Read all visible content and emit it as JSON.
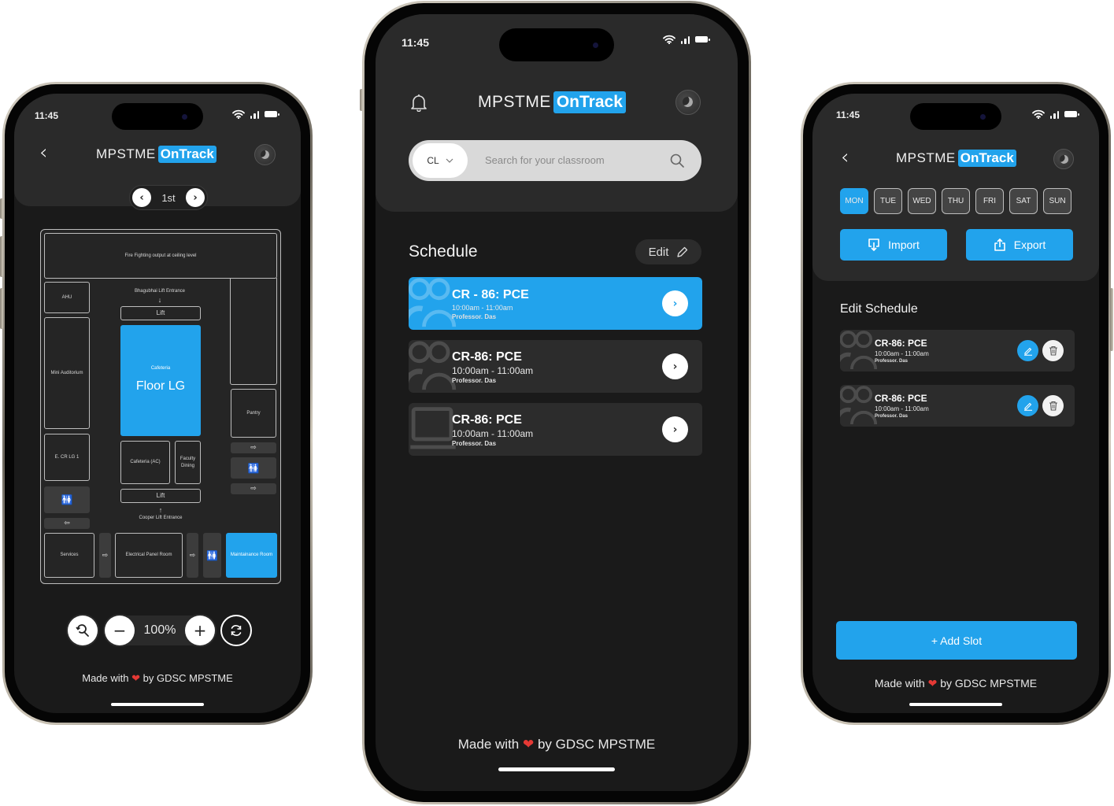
{
  "status_bar": {
    "time": "11:45"
  },
  "brand": {
    "primary": "MPSTME",
    "accent": "OnTrack",
    "accent_color": "#22a3ec"
  },
  "footer": {
    "made_with": "Made with",
    "heart": "❤",
    "by": "by GDSC MPSTME"
  },
  "map_screen": {
    "floor_selector": {
      "prev_icon": "chevron-left-icon",
      "label": "1st",
      "next_icon": "chevron-right-icon"
    },
    "map": {
      "title": "Floor LG",
      "rooms": {
        "fire": "Fire Fighting output at ceiling level",
        "ahu": "AHU",
        "mini_auditorium": "Mini Auditorium",
        "ecr": "E. CR LG 1",
        "services": "Services",
        "bhagubhai_entrance": "Bhagubhai Lift Entrance",
        "lift_top": "Lift",
        "cafeteria_label": "Cafeteria",
        "cafeteria_ac": "Cafeteria (AC)",
        "faculty_dining": "Faculty Dining",
        "lift_bottom": "Lift",
        "cooper_entrance": "Cooper Lift Entrance",
        "electrical": "Electrical Panel Room",
        "maintenance": "Maintainance Room",
        "pantry": "Pantry"
      },
      "arrow_down": "↓",
      "arrow_up": "↑"
    },
    "zoom_controls": {
      "reset_icon": "search-reset-icon",
      "zoom_out": "−",
      "level": "100%",
      "zoom_in": "+",
      "rotate_icon": "refresh-icon"
    }
  },
  "home_screen": {
    "search": {
      "filter": "CL",
      "placeholder": "Search for your classroom"
    },
    "schedule": {
      "title": "Schedule",
      "edit_label": "Edit",
      "items": [
        {
          "room": "CR - 86: PCE",
          "time": "10:00am - 11:00am",
          "professor": "Professor. Das",
          "active": true,
          "icon": "people-icon"
        },
        {
          "room": "CR-86: PCE",
          "time": "10:00am - 11:00am",
          "professor": "Professor. Das",
          "active": false,
          "icon": "people-icon"
        },
        {
          "room": "CR-86: PCE",
          "time": "10:00am - 11:00am",
          "professor": "Professor. Das",
          "active": false,
          "icon": "laptop-icon"
        }
      ]
    }
  },
  "edit_screen": {
    "days": [
      "MON",
      "TUE",
      "WED",
      "THU",
      "FRI",
      "SAT",
      "SUN"
    ],
    "selected_day": "MON",
    "import_label": "Import",
    "export_label": "Export",
    "title": "Edit Schedule",
    "items": [
      {
        "room": "CR-86: PCE",
        "time": "10:00am - 11:00am",
        "professor": "Professor. Das"
      },
      {
        "room": "CR-86: PCE",
        "time": "10:00am - 11:00am",
        "professor": "Professor. Das"
      }
    ],
    "add_slot_label": "+ Add Slot"
  }
}
